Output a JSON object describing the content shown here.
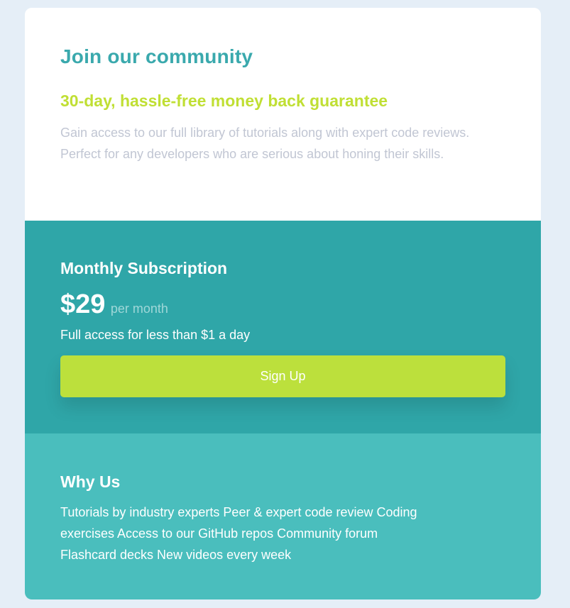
{
  "header": {
    "title": "Join our community",
    "subtitle": "30-day, hassle-free money back guarantee",
    "description": "Gain access to our full library of tutorials along with expert code reviews. Perfect for any developers who are serious about honing their skills."
  },
  "subscription": {
    "title": "Monthly Subscription",
    "price": "$29",
    "period": "per month",
    "access_text": "Full access for less than $1 a day",
    "signup_label": "Sign Up"
  },
  "why_us": {
    "title": "Why Us",
    "features": "Tutorials by industry experts Peer & expert code review Coding exercises Access to our GitHub repos Community forum Flashcard decks New videos every week"
  },
  "colors": {
    "page_background": "#e5eef7",
    "title_teal": "#3aa9ad",
    "guarantee_lime": "#c0df34",
    "description_gray": "#c1c6d3",
    "subscription_background": "#2fa6a8",
    "signup_button": "#bce03c",
    "why_background": "#4abebd"
  }
}
